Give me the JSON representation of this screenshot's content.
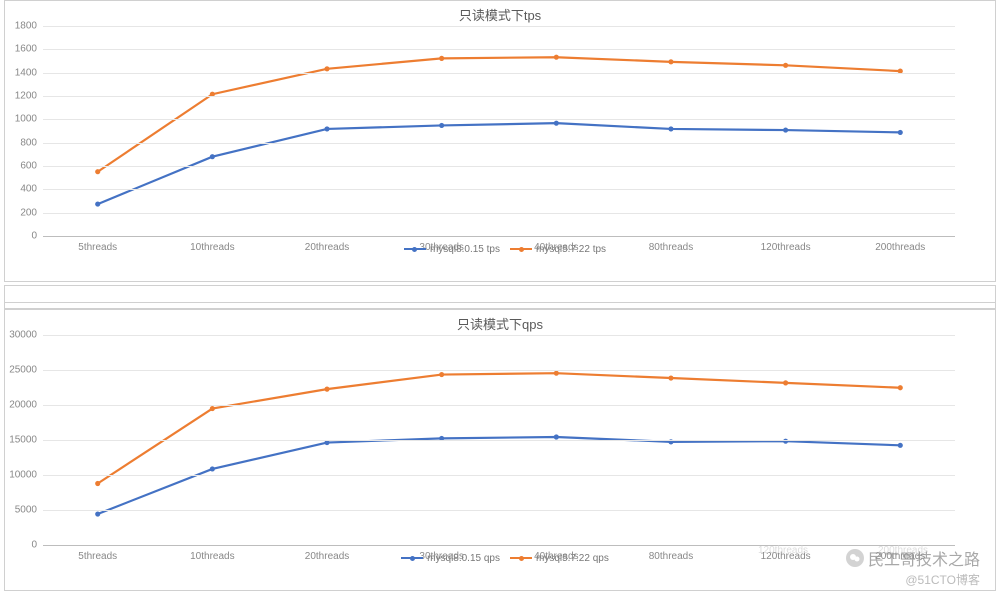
{
  "watermark_brand": "民工哥技术之路",
  "watermark_source": "@51CTO博客",
  "chart_data": [
    {
      "type": "line",
      "title": "只读模式下tps",
      "xlabel": "",
      "ylabel": "",
      "ylim": [
        0,
        1800
      ],
      "ystep": 200,
      "categories": [
        "5threads",
        "10threads",
        "20threads",
        "30threads",
        "40threads",
        "80threads",
        "120threads",
        "200threads"
      ],
      "series": [
        {
          "name": "mysql8.0.15 tps",
          "color": "#4472C4",
          "values": [
            260,
            670,
            910,
            940,
            960,
            910,
            900,
            880
          ]
        },
        {
          "name": "mysql5.7.22 tps",
          "color": "#ED7D31",
          "values": [
            540,
            1210,
            1430,
            1520,
            1530,
            1490,
            1460,
            1410
          ]
        }
      ]
    },
    {
      "type": "line",
      "title": "只读模式下qps",
      "xlabel": "",
      "ylabel": "",
      "ylim": [
        0,
        30000
      ],
      "ystep": 5000,
      "categories": [
        "5threads",
        "10threads",
        "20threads",
        "30threads",
        "40threads",
        "80threads",
        "120threads",
        "200threads"
      ],
      "series": [
        {
          "name": "mysql8.0.15 qps",
          "color": "#4472C4",
          "values": [
            4200,
            10700,
            14500,
            15100,
            15300,
            14600,
            14700,
            14100
          ]
        },
        {
          "name": "mysql5.7.22 qps",
          "color": "#ED7D31",
          "values": [
            8600,
            19400,
            22200,
            24300,
            24500,
            23800,
            23100,
            22400
          ]
        }
      ]
    }
  ]
}
